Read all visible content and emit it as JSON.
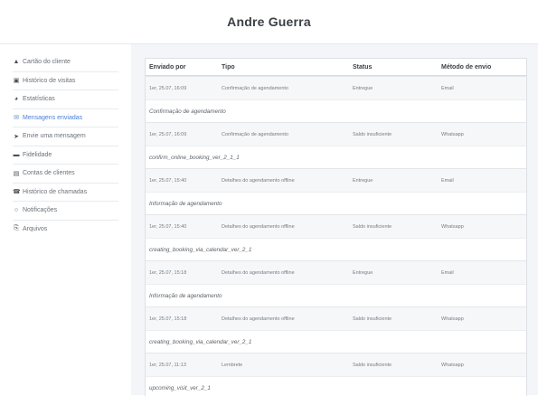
{
  "header": {
    "title": "Andre Guerra"
  },
  "sidebar": {
    "items": [
      {
        "label": "Cartão do cliente",
        "icon": "user-icon",
        "glyph": "▲"
      },
      {
        "label": "Histórico de visitas",
        "icon": "calendar-icon",
        "glyph": "▣"
      },
      {
        "label": "Estatísticas",
        "icon": "pie-chart-icon",
        "glyph": "◕"
      },
      {
        "label": "Mensagens enviadas",
        "icon": "envelope-icon",
        "glyph": "✉",
        "active": true
      },
      {
        "label": "Envie uma mensagem",
        "icon": "paper-plane-icon",
        "glyph": "➤"
      },
      {
        "label": "Fidelidade",
        "icon": "card-icon",
        "glyph": "▬"
      },
      {
        "label": "Contas de clientes",
        "icon": "wallet-icon",
        "glyph": "▤"
      },
      {
        "label": "Histórico de chamadas",
        "icon": "phone-icon",
        "glyph": "☎"
      },
      {
        "label": "Notificações",
        "icon": "chat-bubble-icon",
        "glyph": "○"
      },
      {
        "label": "Arquivos",
        "icon": "paperclip-icon",
        "glyph": "⎘"
      }
    ]
  },
  "table": {
    "headers": {
      "sent_by": "Enviado por",
      "type": "Tipo",
      "status": "Status",
      "method": "Método de envio"
    },
    "rows": [
      {
        "date": "1er, 25.07, 16:09",
        "type": "Confirmação de agendamento",
        "status": "Entregue",
        "method": "Email",
        "template": "Confirmação de agendamento"
      },
      {
        "date": "1er, 25.07, 16:09",
        "type": "Confirmação de agendamento",
        "status": "Saldo insuficiente",
        "method": "Whatsapp",
        "template": "confirm_online_booking_ver_2_1_1"
      },
      {
        "date": "1er, 25.07, 15:40",
        "type": "Detalhes do agendamento offline",
        "status": "Entregue",
        "method": "Email",
        "template": "Informação de agendamento"
      },
      {
        "date": "1er, 25.07, 15:40",
        "type": "Detalhes do agendamento offline",
        "status": "Saldo insuficiente",
        "method": "Whatsapp",
        "template": "creating_booking_via_calendar_ver_2_1"
      },
      {
        "date": "1er, 25.07, 15:18",
        "type": "Detalhes do agendamento offline",
        "status": "Entregue",
        "method": "Email",
        "template": "Informação de agendamento"
      },
      {
        "date": "1er, 25.07, 15:18",
        "type": "Detalhes do agendamento offline",
        "status": "Saldo insuficiente",
        "method": "Whatsapp",
        "template": "creating_booking_via_calendar_ver_2_1"
      },
      {
        "date": "1er, 25.07, 11:13",
        "type": "Lembrete",
        "status": "Saldo insuficiente",
        "method": "Whatsapp",
        "template": "upcoming_visit_ver_2_1"
      }
    ]
  }
}
